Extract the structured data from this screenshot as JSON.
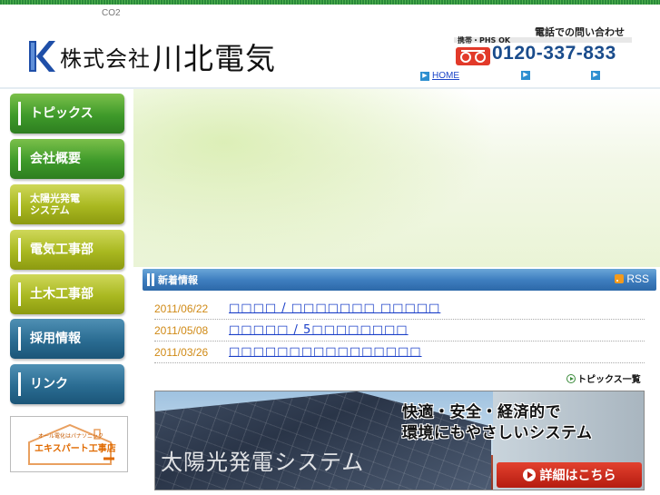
{
  "header": {
    "co2_label": "CO2",
    "company_prefix": "株式会社",
    "company_name": "川北電気",
    "phone": {
      "heading": "電話での問い合わせ",
      "subnote": "携帯・PHS OK",
      "number": "0120-337-833"
    },
    "links": [
      {
        "label": "HOME"
      },
      {
        "label": ""
      },
      {
        "label": ""
      }
    ]
  },
  "sidebar": {
    "items": [
      {
        "label": "トピックス",
        "color": "#3e9a2a"
      },
      {
        "label": "会社概要",
        "color": "#3e9a2a"
      },
      {
        "label_line1": "太陽光発電",
        "label_line2": "システム",
        "color": "#a9b820"
      },
      {
        "label": "電気工事部",
        "color": "#a9b820"
      },
      {
        "label": "土木工事部",
        "color": "#a9b820"
      },
      {
        "label": "採用情報",
        "color": "#2a6c92"
      },
      {
        "label": "リンク",
        "color": "#2a6c92"
      }
    ],
    "banner": {
      "sub": "オール電化はパナソニック",
      "main": "エキスパート工事店"
    }
  },
  "news": {
    "title": "新着情報",
    "rss_label": "RSS",
    "items": [
      {
        "date": "2011/06/22",
        "title": "□□□□ / □□□□□□□ □□□□□"
      },
      {
        "date": "2011/05/08",
        "title": "□□□□□ / 5□□□□□□□□"
      },
      {
        "date": "2011/03/26",
        "title": "□□□□□□□□□□□□□□□□"
      }
    ],
    "more_label": "トピックス一覧"
  },
  "solar_banner": {
    "caption_line1": "快適・安全・経済的で",
    "caption_line2": "環境にもやさしいシステム",
    "title": "太陽光発電システム",
    "button_label": "詳細はこちら"
  },
  "colors": {
    "link_blue": "#1a3fc8",
    "date_orange": "#d08a16",
    "news_bar": "#3f7fc0",
    "phone_blue": "#1a4c8c",
    "detail_red": "#b51c10"
  }
}
